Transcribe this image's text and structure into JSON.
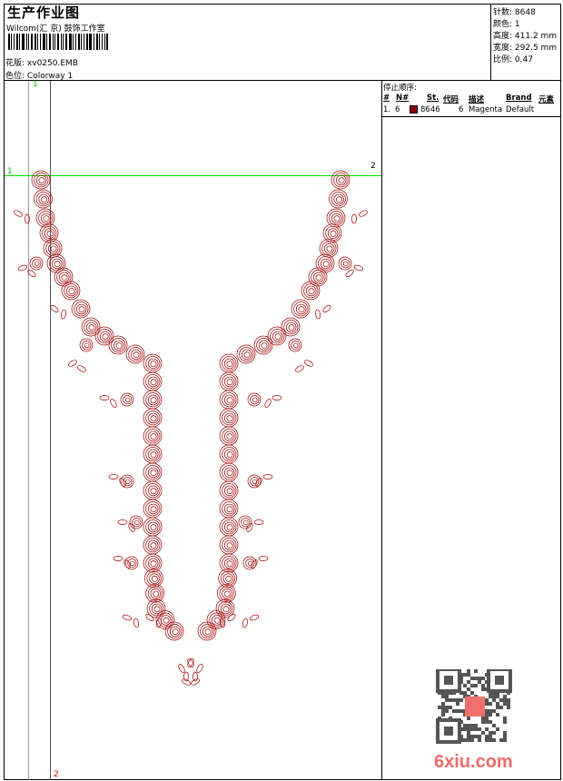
{
  "header": {
    "title": "生产作业图",
    "company": "Wilcom(汇 京) 鼓饰工作室",
    "design_label": "花版:",
    "design_value": "xv0250.EMB",
    "colorway_label": "色位:",
    "colorway_value": "Colorway 1"
  },
  "info": {
    "stitches_label": "针数:",
    "stitches": "8648",
    "colors_label": "颜色:",
    "colors": "1",
    "height_label": "高度:",
    "height": "411.2 mm",
    "width_label": "宽度:",
    "width": "292.5 mm",
    "scale_label": "比例:",
    "scale": "0.47"
  },
  "stop_sequence": {
    "title": "停止顺序:",
    "columns": [
      "#",
      "N#",
      "St.",
      "代码",
      "描述",
      "Brand",
      "元素"
    ],
    "rows": [
      {
        "index": "1.",
        "needle": "6",
        "color": "#8b0000",
        "stitches": "8646",
        "code": "6",
        "description": "Magenta",
        "brand": "Default"
      }
    ]
  },
  "markers": {
    "top_left": "1",
    "bottom": "2",
    "left": "1",
    "right": "2"
  },
  "watermark": {
    "site": "6xiu.com"
  },
  "colors": {
    "thread": "#a00000",
    "guide": "#00e000",
    "marker_red": "#e00000"
  }
}
